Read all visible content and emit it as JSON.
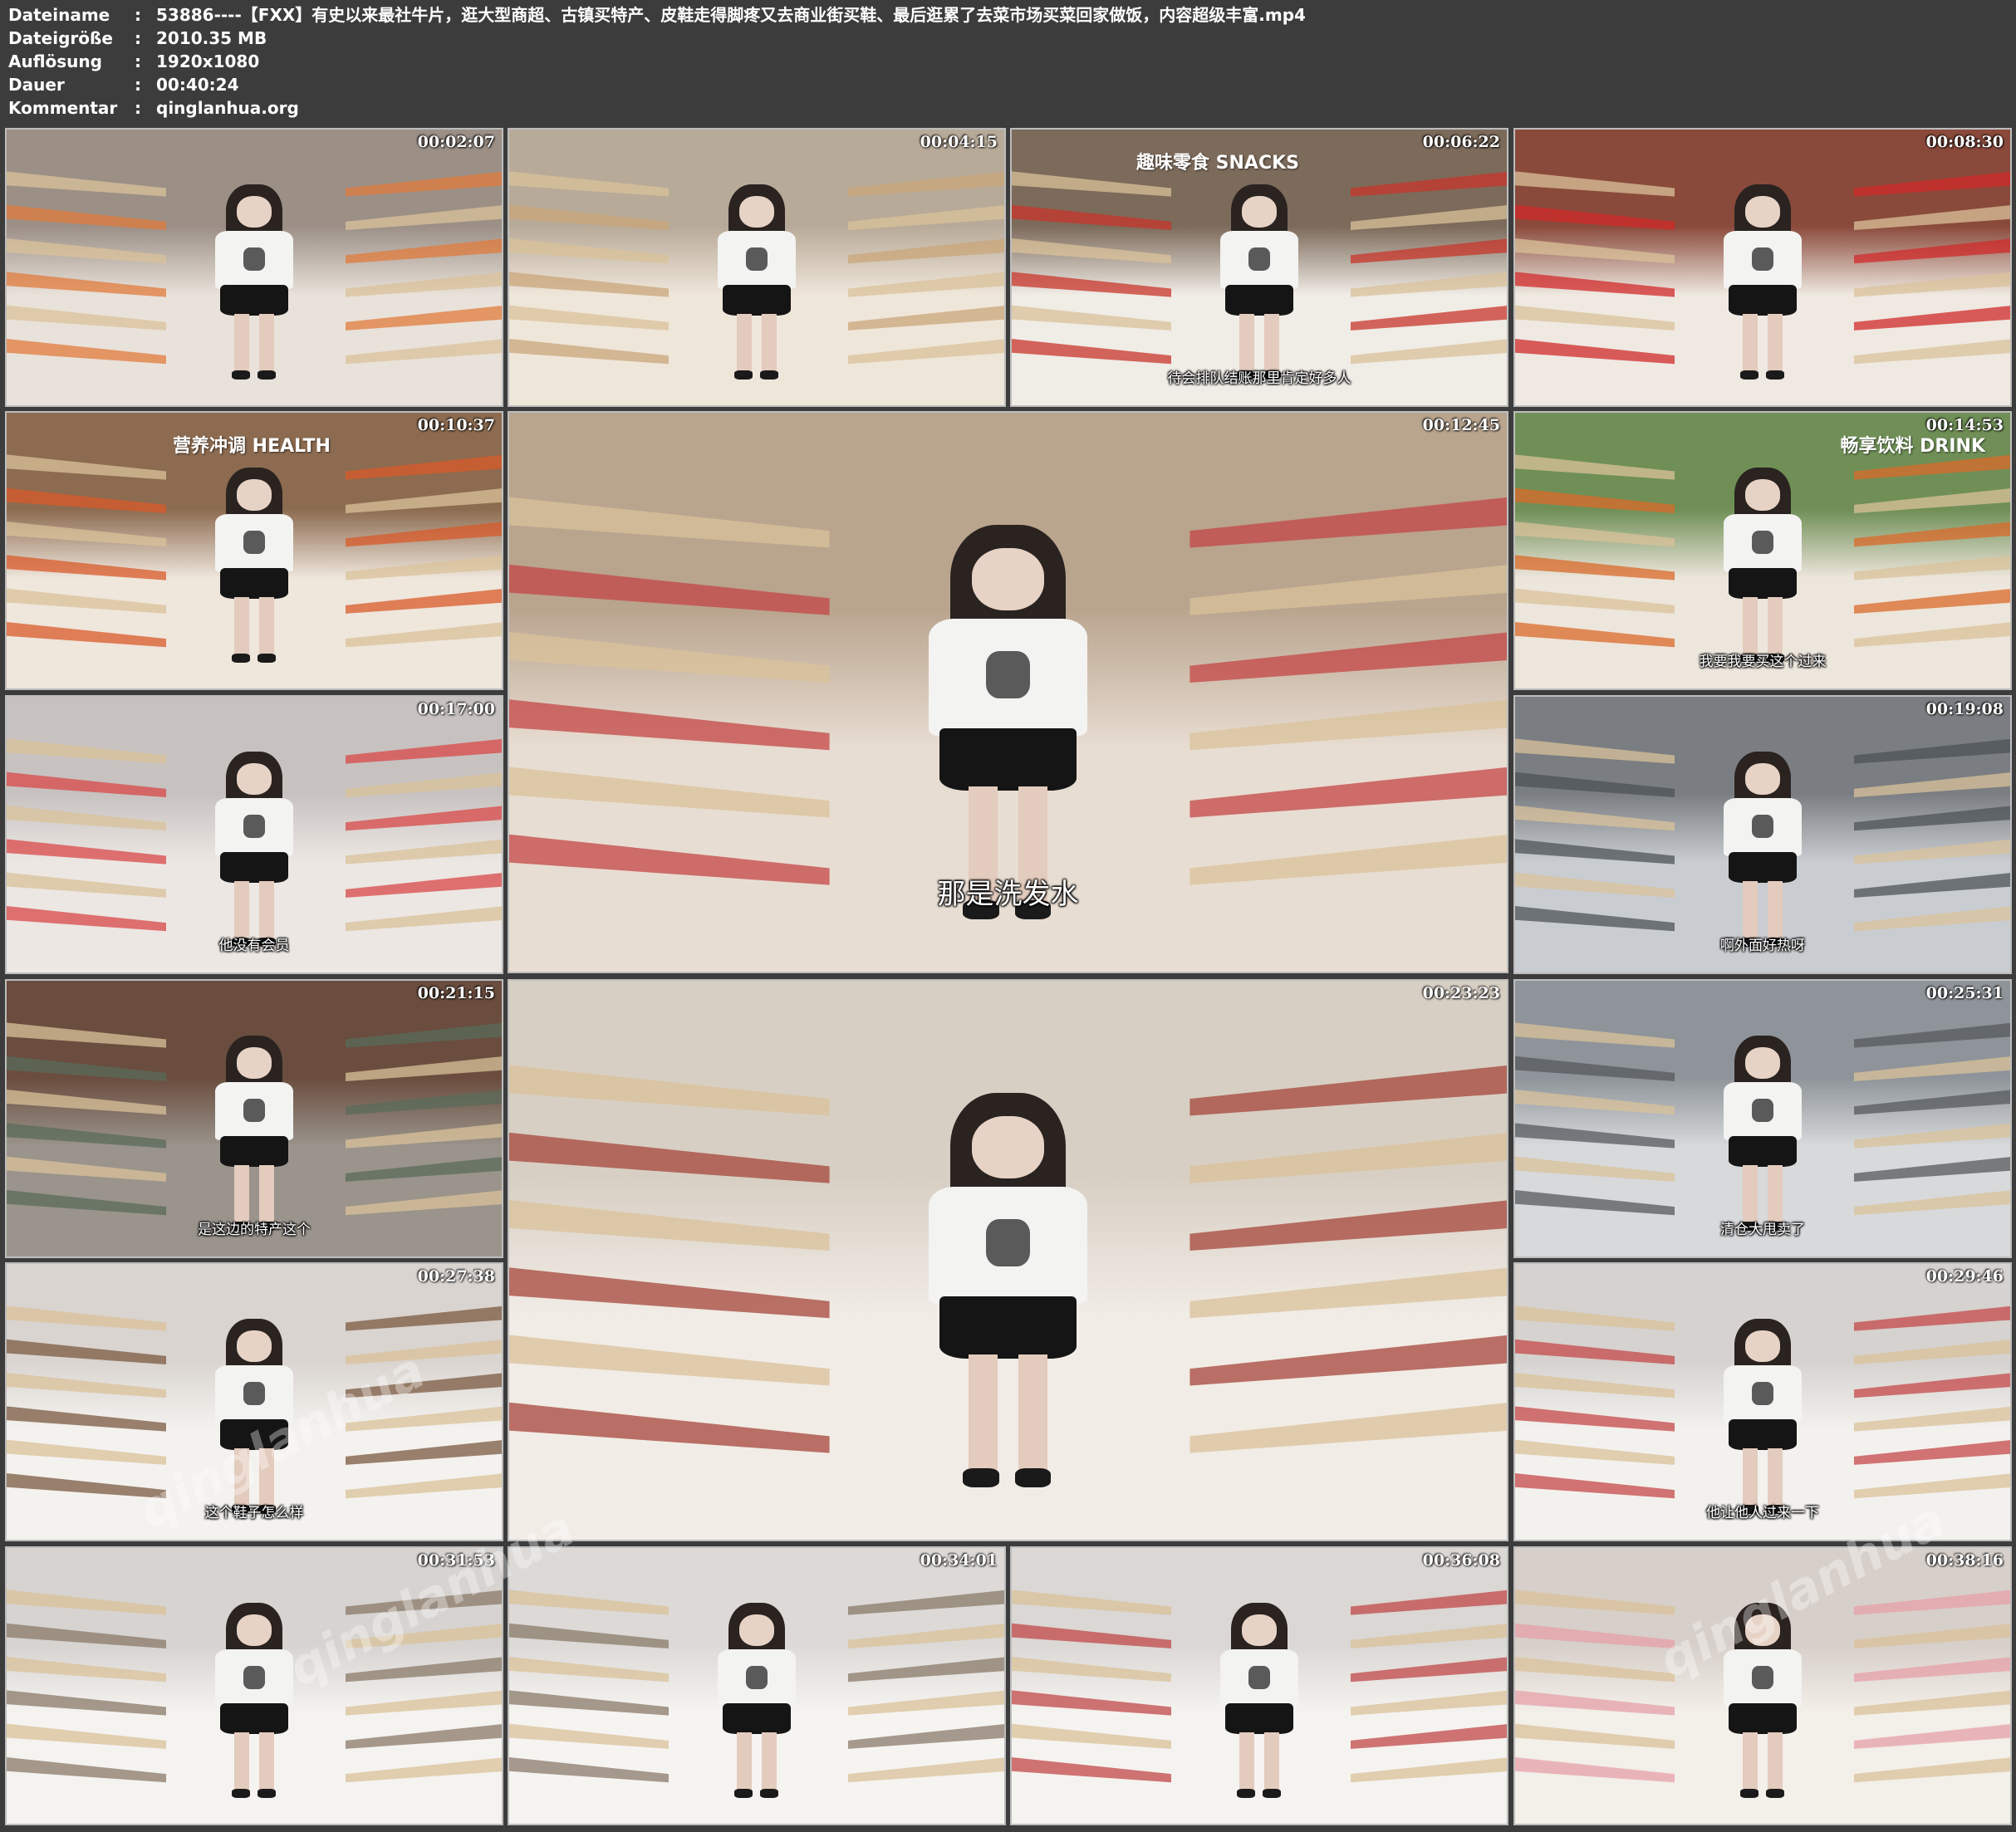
{
  "meta": {
    "rows": [
      {
        "key": "Dateiname",
        "value": "53886----【FXX】有史以来最社牛片，逛大型商超、古镇买特产、皮鞋走得脚疼又去商业街买鞋、最后逛累了去菜市场买菜回家做饭，内容超级丰富.mp4"
      },
      {
        "key": "Dateigröße",
        "value": "2010.35 MB"
      },
      {
        "key": "Auflösung",
        "value": "1920x1080"
      },
      {
        "key": "Dauer",
        "value": "00:40:24"
      },
      {
        "key": "Kommentar",
        "value": "qinglanhua.org"
      }
    ],
    "separator": ":"
  },
  "thumbnails": [
    {
      "time": "00:02:07",
      "subtitle": "",
      "sign": ""
    },
    {
      "time": "00:04:15",
      "subtitle": "",
      "sign": ""
    },
    {
      "time": "00:06:22",
      "subtitle": "待会排队结账那里肯定好多人",
      "sign": "趣味零食 SNACKS"
    },
    {
      "time": "00:08:30",
      "subtitle": "",
      "sign": ""
    },
    {
      "time": "00:10:37",
      "subtitle": "",
      "sign": "营养冲调 HEALTH"
    },
    {
      "time": "00:12:45",
      "subtitle": "那是洗发水",
      "sign": ""
    },
    {
      "time": "00:14:53",
      "subtitle": "我要我要买这个过来",
      "sign": "畅享饮料 DRINK"
    },
    {
      "time": "00:17:00",
      "subtitle": "他没有会员",
      "sign": ""
    },
    {
      "time": "00:19:08",
      "subtitle": "啊外面好热呀",
      "sign": ""
    },
    {
      "time": "00:21:15",
      "subtitle": "是这边的特产这个",
      "sign": ""
    },
    {
      "time": "00:23:23",
      "subtitle": "",
      "sign": ""
    },
    {
      "time": "00:25:31",
      "subtitle": "清仓大甩卖了",
      "sign": ""
    },
    {
      "time": "00:27:38",
      "subtitle": "这个鞋子怎么样",
      "sign": ""
    },
    {
      "time": "00:29:46",
      "subtitle": "他让他人过来一下",
      "sign": ""
    },
    {
      "time": "00:31:53",
      "subtitle": "",
      "sign": ""
    },
    {
      "time": "00:34:01",
      "subtitle": "",
      "sign": ""
    },
    {
      "time": "00:36:08",
      "subtitle": "",
      "sign": ""
    },
    {
      "time": "00:38:16",
      "subtitle": "",
      "sign": ""
    }
  ],
  "watermark": "qinglanhua",
  "colors": {
    "background": "#3c3c3c",
    "border": "#bdbdbd",
    "text": "#ffffff"
  }
}
